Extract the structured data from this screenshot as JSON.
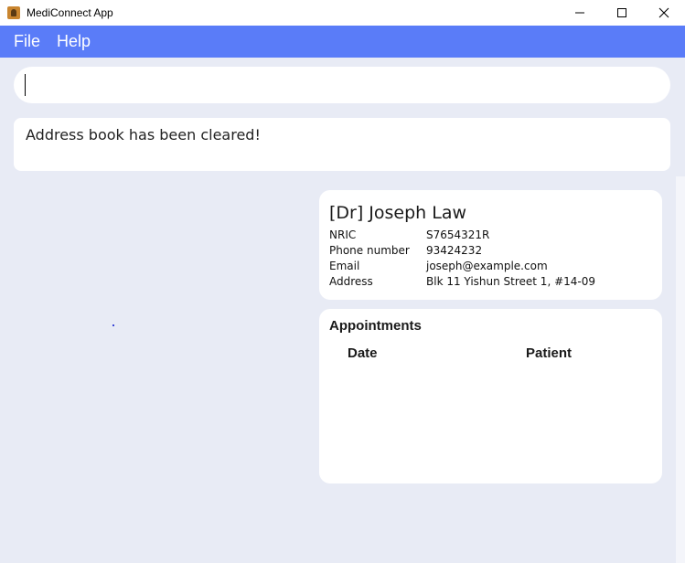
{
  "window": {
    "title": "MediConnect App",
    "controls": [
      "minimize-icon",
      "maximize-icon",
      "close-icon"
    ]
  },
  "menu": {
    "items": [
      {
        "label": "File"
      },
      {
        "label": "Help"
      }
    ]
  },
  "command": {
    "value": "",
    "placeholder": ""
  },
  "result": {
    "text": "Address book has been cleared!"
  },
  "doctor": {
    "name": "[Dr] Joseph Law",
    "fields": [
      {
        "label": "NRIC",
        "value": "S7654321R"
      },
      {
        "label": "Phone number",
        "value": "93424232"
      },
      {
        "label": "Email",
        "value": "joseph@example.com"
      },
      {
        "label": "Address",
        "value": "Blk 11 Yishun Street 1, #14-09"
      }
    ]
  },
  "appointments": {
    "title": "Appointments",
    "columns": [
      "Date",
      "Patient"
    ],
    "rows": []
  },
  "colors": {
    "menu_bar": "#5a7cf8",
    "background": "#e8ebf5",
    "card": "#ffffff"
  }
}
